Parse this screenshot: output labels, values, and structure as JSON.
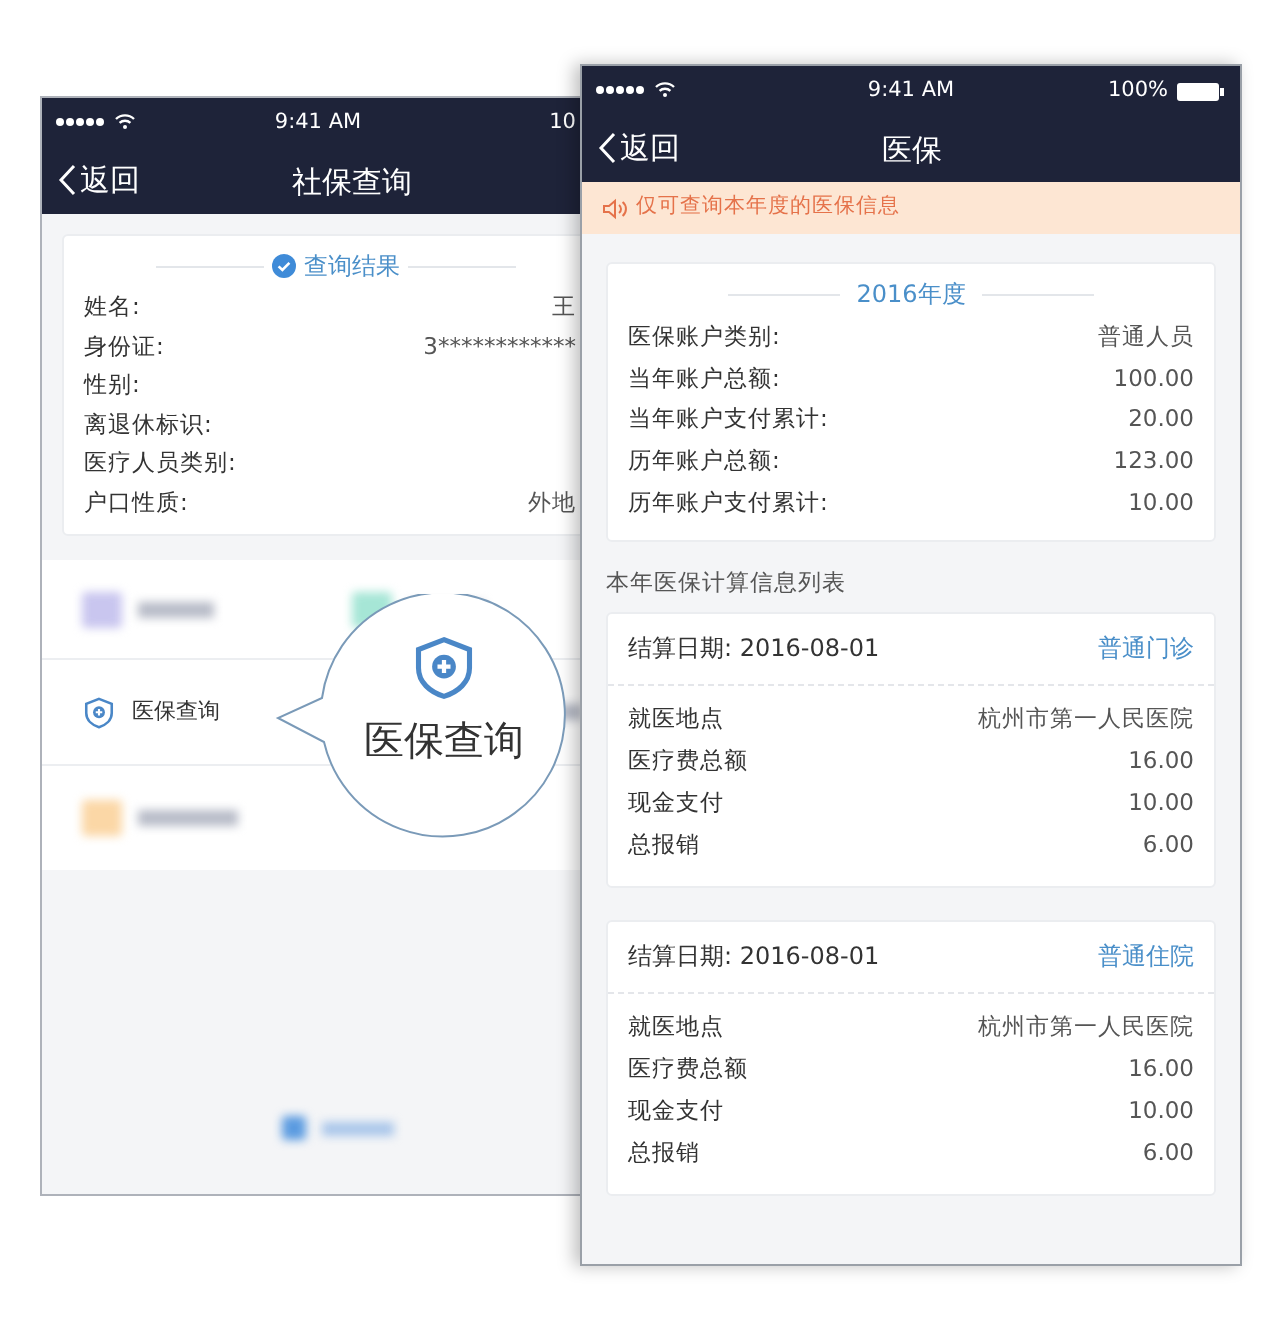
{
  "social_security_screen": {
    "status_bar": {
      "time": "9:41 AM",
      "battery": "10"
    },
    "back": "返回",
    "title": "社保查询",
    "result_card": {
      "heading": "查询结果",
      "rows": [
        {
          "label": "姓名:",
          "value": "王"
        },
        {
          "label": "身份证:",
          "value": "3************"
        },
        {
          "label": "性别:"
        },
        {
          "label": "离退休标识:"
        },
        {
          "label": "医疗人员类别:"
        },
        {
          "label": "户口性质:",
          "value": "外地"
        }
      ]
    },
    "menu_item": {
      "label": "医保查询"
    },
    "callout": {
      "label": "医保查询"
    }
  },
  "medical_screen": {
    "status_bar": {
      "time": "9:41 AM",
      "battery": "100%"
    },
    "back": "返回",
    "title": "医保",
    "notice": "仅可查询本年度的医保信息",
    "summary": {
      "year": "2016年度",
      "rows": [
        {
          "label": "医保账户类别:",
          "value": "普通人员"
        },
        {
          "label": "当年账户总额:",
          "value": "100.00"
        },
        {
          "label": "当年账户支付累计:",
          "value": "20.00"
        },
        {
          "label": "历年账户总额:",
          "value": "123.00"
        },
        {
          "label": "历年账户支付累计:",
          "value": "10.00"
        }
      ]
    },
    "list_title": "本年医保计算信息列表",
    "records": [
      {
        "date": "结算日期: 2016-08-01",
        "type": "普通门诊",
        "rows": [
          {
            "label": "就医地点",
            "value": "杭州市第一人民医院"
          },
          {
            "label": "医疗费总额",
            "value": "16.00"
          },
          {
            "label": "现金支付",
            "value": "10.00"
          },
          {
            "label": "总报销",
            "value": "6.00"
          }
        ]
      },
      {
        "date": "结算日期: 2016-08-01",
        "type": "普通住院",
        "rows": [
          {
            "label": "就医地点",
            "value": "杭州市第一人民医院"
          },
          {
            "label": "医疗费总额",
            "value": "16.00"
          },
          {
            "label": "现金支付",
            "value": "10.00"
          },
          {
            "label": "总报销",
            "value": "6.00"
          }
        ]
      }
    ]
  }
}
